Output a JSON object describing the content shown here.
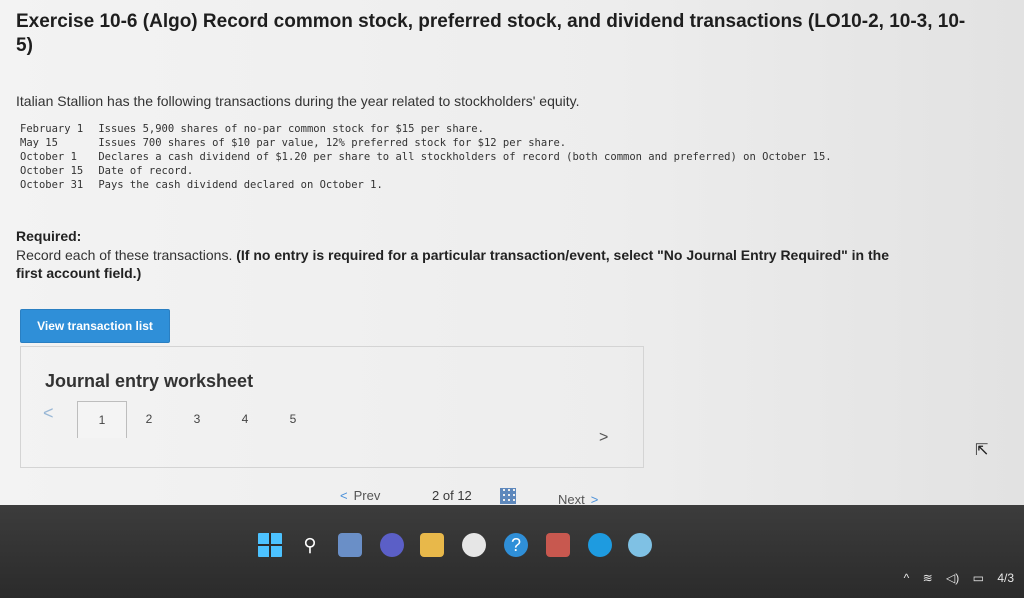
{
  "title": "Exercise 10-6 (Algo) Record common stock, preferred stock, and dividend transactions (LO10-2, 10-3, 10-5)",
  "intro": "Italian Stallion has the following transactions during the year related to stockholders' equity.",
  "transactions": [
    {
      "date": "February 1",
      "text": "Issues 5,900 shares of no-par common stock for $15 per share."
    },
    {
      "date": "May 15",
      "text": "Issues 700 shares of $10 par value, 12% preferred stock for $12 per share."
    },
    {
      "date": "October 1",
      "text": "Declares a cash dividend of $1.20 per share to all stockholders of record (both common and preferred) on October 15."
    },
    {
      "date": "October 15",
      "text": "Date of record."
    },
    {
      "date": "October 31",
      "text": "Pays the cash dividend declared on October 1."
    }
  ],
  "required": {
    "heading": "Required:",
    "text": "Record each of these transactions.",
    "note": "(If no entry is required for a particular transaction/event, select \"No Journal Entry Required\" in the first account field.)"
  },
  "view_button": "View transaction list",
  "worksheet": {
    "title": "Journal entry worksheet",
    "tabs": [
      "1",
      "2",
      "3",
      "4",
      "5"
    ],
    "active_tab": "1",
    "prev_arrow": "<",
    "next_arrow": ">"
  },
  "pager": {
    "prev_label": "Prev",
    "current": "2",
    "of_label": "of 12",
    "next_label": "Next",
    "prev_chevron": "<",
    "next_chevron": ">"
  },
  "taskbar": {
    "icons": [
      "windows-start-icon",
      "search-icon",
      "photos-icon",
      "teams-icon",
      "file-explorer-icon",
      "store-icon",
      "help-icon",
      "game-icon",
      "edge-icon",
      "chrome-icon"
    ],
    "tray": {
      "chevron": "^",
      "wifi": "wifi-icon",
      "volume": "volume-icon",
      "battery": "battery-icon",
      "clock": "4/3"
    }
  },
  "colors": {
    "accent": "#2f8fd8",
    "taskbar": "#2b2b2b",
    "page_bg": "#ededed"
  }
}
